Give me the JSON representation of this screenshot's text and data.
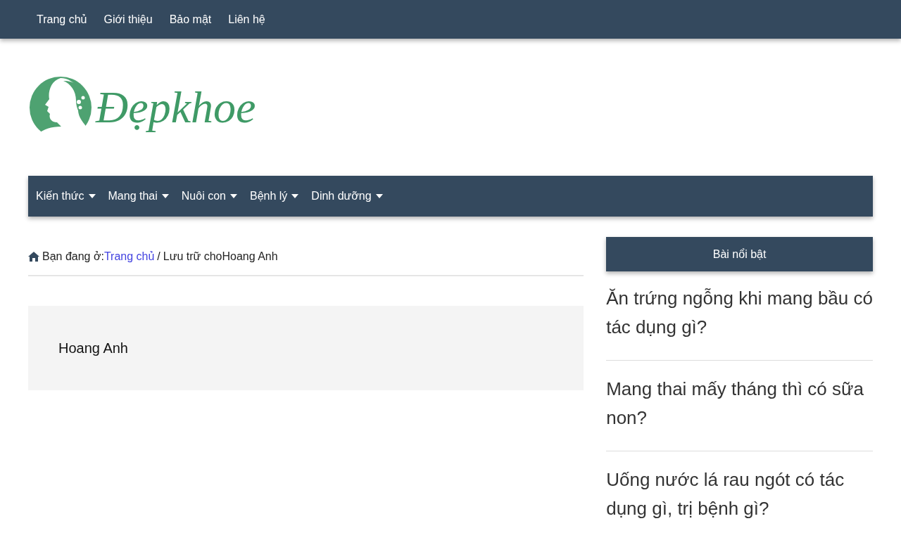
{
  "top_menu": [
    {
      "label": "Trang chủ"
    },
    {
      "label": "Giới thiệu"
    },
    {
      "label": "Bảo mật"
    },
    {
      "label": "Liên hệ"
    }
  ],
  "logo": {
    "text": "Đẹpkhoe"
  },
  "main_menu": [
    {
      "label": "Kiến thức"
    },
    {
      "label": "Mang thai"
    },
    {
      "label": "Nuôi con"
    },
    {
      "label": "Bệnh lý"
    },
    {
      "label": "Dinh dưỡng"
    }
  ],
  "breadcrumb": {
    "prefix": "Bạn đang ở:",
    "home": "Trang chủ",
    "separator": "/",
    "current": "Lưu trữ choHoang Anh"
  },
  "author_box": {
    "name": "Hoang Anh"
  },
  "sidebar": {
    "title": "Bài nổi bật",
    "posts": [
      {
        "title": "Ăn trứng ngỗng khi mang bầu có tác dụng gì?"
      },
      {
        "title": "Mang thai mấy tháng thì có sữa non?"
      },
      {
        "title": "Uống nước lá rau ngót có tác dụng gì, trị bệnh gì?"
      }
    ]
  }
}
